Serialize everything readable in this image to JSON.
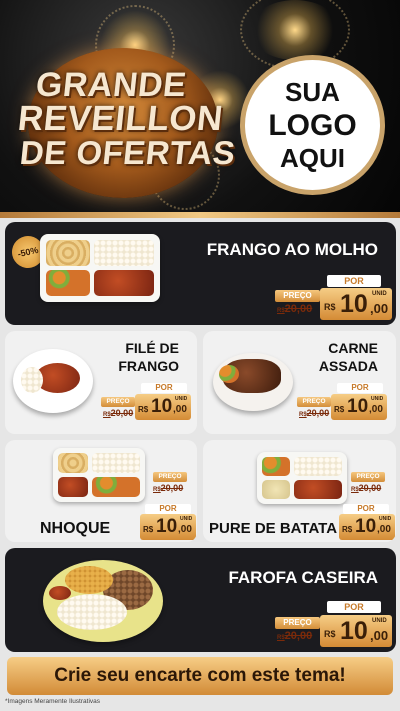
{
  "header": {
    "title_line1": "GRANDE",
    "title_line2": "REVEILLON",
    "title_line3": "DE OFERTAS",
    "logo_line1": "SUA",
    "logo_line2": "LOGO",
    "logo_line3": "AQUI"
  },
  "labels": {
    "por": "POR",
    "preco": "PREÇO",
    "currency": "R$",
    "unit": "UNID"
  },
  "products": [
    {
      "name": "FRANGO AO MOLHO",
      "old_price": "20,00",
      "old_prefix": "R$",
      "price": "10",
      "cents": ",00",
      "badge": "-50%"
    },
    {
      "name_line1": "FILÉ DE",
      "name_line2": "FRANGO",
      "old_price": "20,00",
      "old_prefix": "R$",
      "price": "10",
      "cents": ",00"
    },
    {
      "name_line1": "CARNE",
      "name_line2": "ASSADA",
      "old_price": "20,00",
      "old_prefix": "R$",
      "price": "10",
      "cents": ",00"
    },
    {
      "name": "NHOQUE",
      "old_price": "20,00",
      "old_prefix": "R$",
      "price": "10",
      "cents": ",00"
    },
    {
      "name": "PURE DE BATATA",
      "old_price": "20,00",
      "old_prefix": "R$",
      "price": "10",
      "cents": ",00"
    },
    {
      "name": "FAROFA CASEIRA",
      "old_price": "20,00",
      "old_prefix": "R$",
      "price": "10",
      "cents": ",00"
    }
  ],
  "cta": "Crie seu encarte com este tema!",
  "footnote": "*Imagens Meramente Ilustrativas",
  "colors": {
    "gold": "#d48b35",
    "dark": "#1b1b1f",
    "light": "#f1f1f1"
  }
}
